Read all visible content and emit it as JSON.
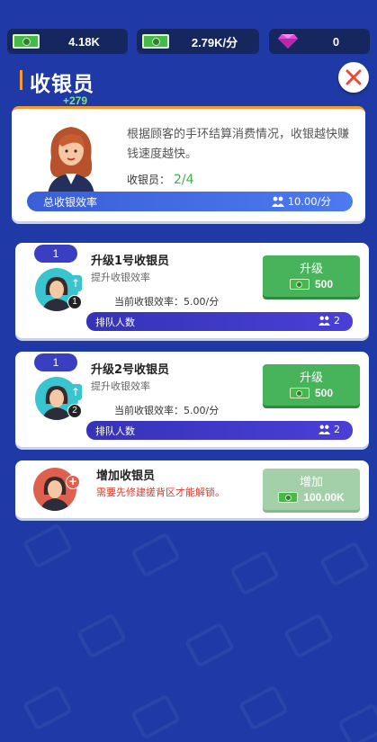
{
  "resources": {
    "cash_total": "4.18K",
    "cash_rate": "2.79K/分",
    "gems": "0"
  },
  "header": {
    "title": "收银员",
    "floating_income": "+279"
  },
  "info": {
    "description": "根据顾客的手环结算消费情况，收银越快赚钱速度越快。",
    "cashier_label": "收银员：",
    "cashier_count": "2/4",
    "efficiency_label": "总收银效率",
    "efficiency_value": "10.00/分"
  },
  "upgrades": [
    {
      "level": "1",
      "index": "1",
      "title": "升级1号收银员",
      "subtitle": "提升收银效率",
      "current": "当前收银效率：5.00/分",
      "queue_label": "排队人数",
      "queue_count": "2",
      "button_label": "升级",
      "cost": "500"
    },
    {
      "level": "1",
      "index": "2",
      "title": "升级2号收银员",
      "subtitle": "提升收银效率",
      "current": "当前收银效率：5.00/分",
      "queue_label": "排队人数",
      "queue_count": "2",
      "button_label": "升级",
      "cost": "500"
    }
  ],
  "add_cashier": {
    "title": "增加收银员",
    "warning": "需要先修建搓背区才能解锁。",
    "button_label": "增加",
    "cost": "100.00K"
  },
  "colors": {
    "background": "#1f3aa6",
    "accent_orange": "#f39b2f",
    "button_green": "#47b35a",
    "queue_purple": "#3a3fc2",
    "warning_red": "#e03a2c"
  },
  "icons": [
    "cash-icon",
    "gem-icon",
    "close-icon",
    "people-icon",
    "up-arrow-icon",
    "plus-icon"
  ]
}
